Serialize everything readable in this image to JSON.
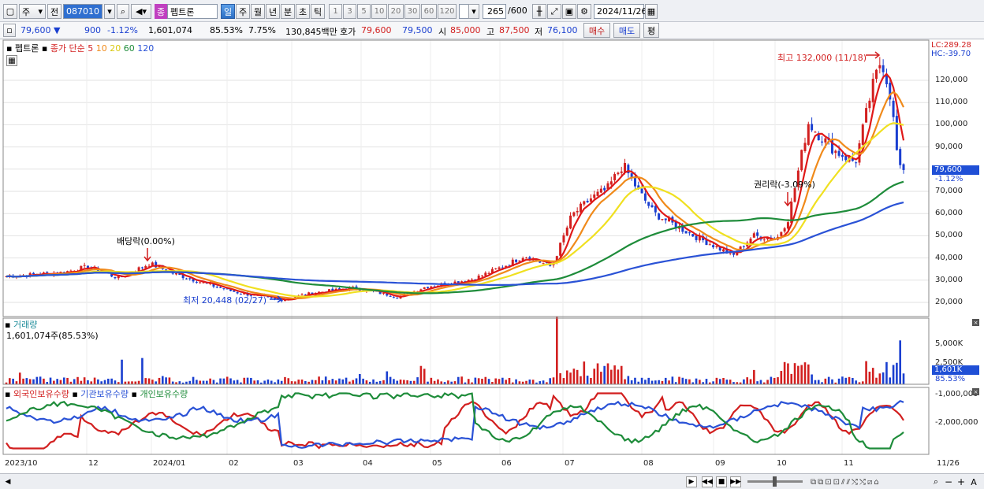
{
  "toolbar": {
    "type_select": "주",
    "prev_label": "전",
    "code": "087010",
    "name": "펩트론",
    "name_badge": "종",
    "periods": [
      "일",
      "주",
      "월",
      "년",
      "분",
      "초",
      "틱"
    ],
    "minute_periods": [
      "1",
      "3",
      "5",
      "10",
      "20",
      "30",
      "60",
      "120"
    ],
    "count": "265",
    "total": "/600",
    "date": "2024/11/26"
  },
  "quote": {
    "price": "79,600",
    "change": "900",
    "change_pct": "-1.12%",
    "volume": "1,601,074",
    "volume_ratio": "85.53%",
    "turnover_rate": "7.75%",
    "amount": "130,845백만",
    "hoga_label": "호가",
    "ask": "79,600",
    "bid": "79,500",
    "open_label": "시",
    "open": "85,000",
    "high_label": "고",
    "high": "87,500",
    "low_label": "저",
    "low": "76,100",
    "buy_button": "매수",
    "sell_button": "매도",
    "eval_button": "평"
  },
  "legend": {
    "name": "펩트론",
    "series_label": "종가 단순",
    "ma": [
      {
        "label": "5",
        "color": "#e01919"
      },
      {
        "label": "10",
        "color": "#f08a1a"
      },
      {
        "label": "20",
        "color": "#f0e020"
      },
      {
        "label": "60",
        "color": "#1e8c3a"
      },
      {
        "label": "120",
        "color": "#2a52d6"
      }
    ]
  },
  "annotations": {
    "max": "최고 132,000 (11/18)",
    "min": "최저 20,448 (02/27)",
    "dividend": "배당락(0.00%)",
    "rights": "권리락(-3.09%)",
    "lc": "LC:289.28",
    "hc": "HC:-39.70"
  },
  "price_axis": [
    "120,000",
    "110,000",
    "100,000",
    "90,000",
    "80,000",
    "70,000",
    "60,000",
    "50,000",
    "40,000",
    "30,000",
    "20,000"
  ],
  "price_tag": {
    "price": "79,600",
    "change": "-1.12%"
  },
  "volume_panel": {
    "title": "거래량",
    "value": "1,601,074주(85.53%)",
    "axis": [
      "5,000K",
      "2,500K"
    ],
    "tag": "1,601K",
    "tag_pct": "85.53%"
  },
  "holdings_panel": {
    "titles": [
      {
        "label": "외국인보유수량",
        "color": "#d21f1f"
      },
      {
        "label": "기관보유수량",
        "color": "#2a52d6"
      },
      {
        "label": "개인보유수량",
        "color": "#1e8c3a"
      }
    ],
    "axis": [
      "-1,000,000",
      "-2,000,000"
    ]
  },
  "x_axis": [
    "2023/10",
    "12",
    "2024/01",
    "02",
    "03",
    "04",
    "05",
    "06",
    "07",
    "08",
    "09",
    "10",
    "11",
    "11/26"
  ],
  "colors": {
    "up": "#d21f1f",
    "down": "#1a3fd0"
  }
}
